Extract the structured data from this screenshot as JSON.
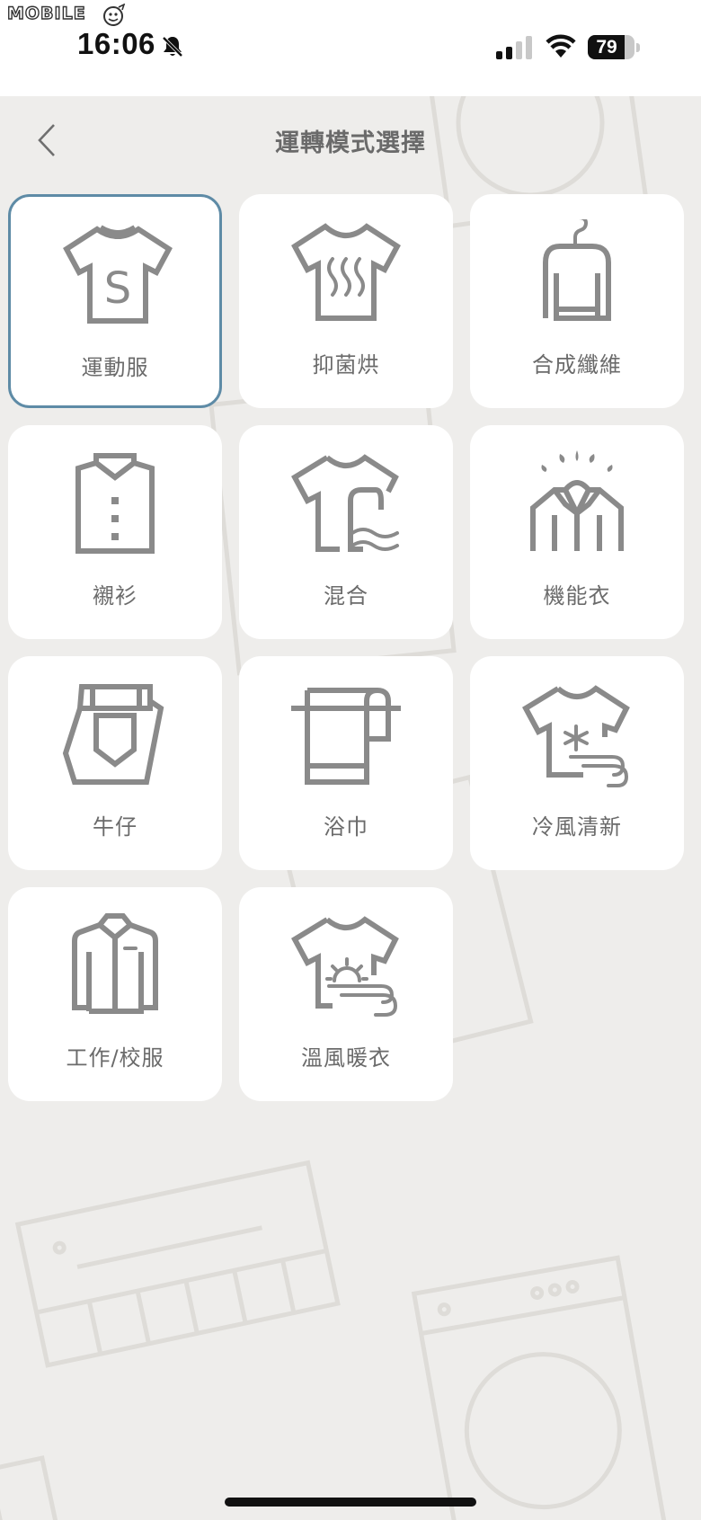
{
  "status_bar": {
    "watermark": "MOBILE",
    "time": "16:06",
    "battery": "79",
    "battery_level": 0.79
  },
  "header": {
    "title": "運轉模式選擇"
  },
  "modes": [
    {
      "label": "運動服",
      "icon": "sport-shirt-icon",
      "selected": true
    },
    {
      "label": "抑菌烘",
      "icon": "antibacterial-dry-icon",
      "selected": false
    },
    {
      "label": "合成纖維",
      "icon": "synthetic-fiber-icon",
      "selected": false
    },
    {
      "label": "襯衫",
      "icon": "dress-shirt-icon",
      "selected": false
    },
    {
      "label": "混合",
      "icon": "mixed-icon",
      "selected": false
    },
    {
      "label": "機能衣",
      "icon": "functional-wear-icon",
      "selected": false
    },
    {
      "label": "牛仔",
      "icon": "denim-icon",
      "selected": false
    },
    {
      "label": "浴巾",
      "icon": "towel-icon",
      "selected": false
    },
    {
      "label": "冷風清新",
      "icon": "cool-air-refresh-icon",
      "selected": false
    },
    {
      "label": "工作/校服",
      "icon": "uniform-icon",
      "selected": false
    },
    {
      "label": "溫風暖衣",
      "icon": "warm-air-icon",
      "selected": false
    }
  ],
  "colors": {
    "background": "#eeedeb",
    "tile": "#ffffff",
    "selected_border": "#5e8ba6",
    "icon": "#8a8a8a"
  }
}
